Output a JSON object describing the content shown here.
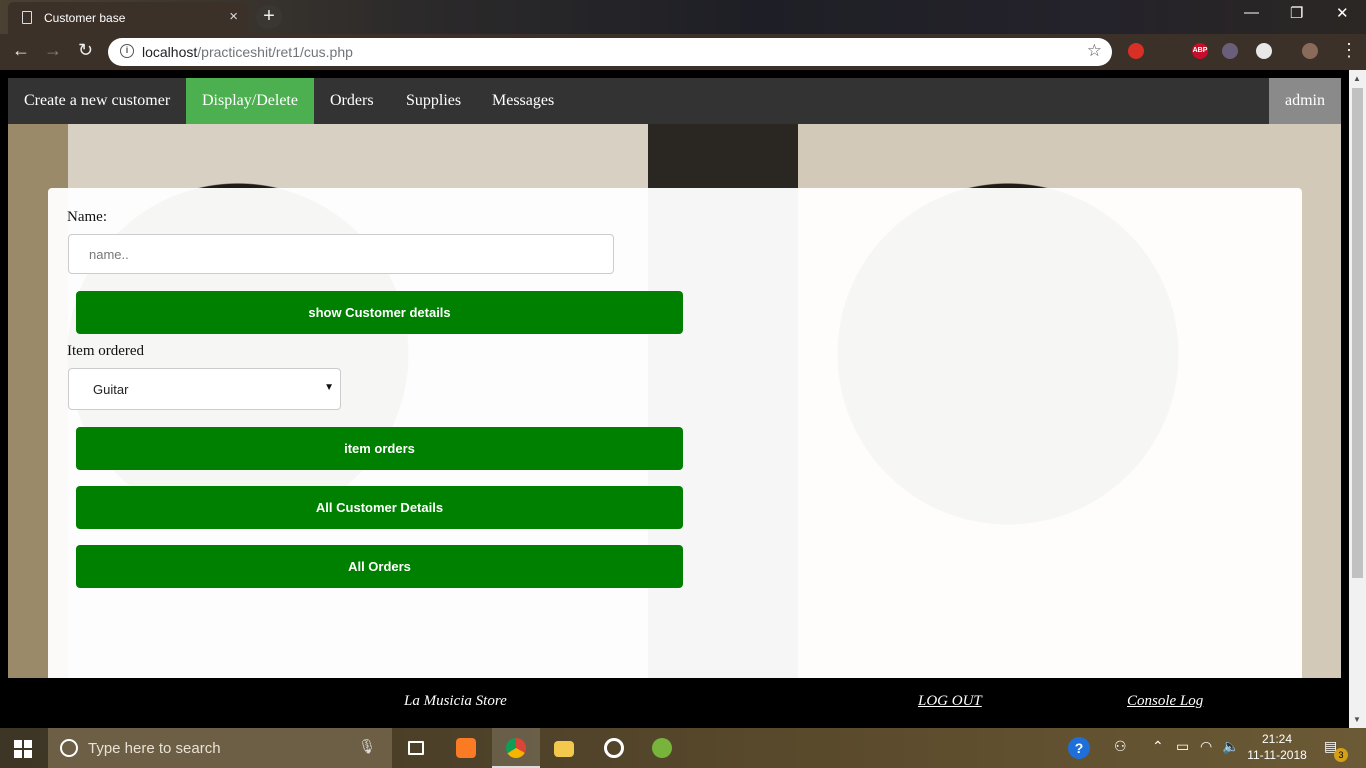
{
  "browser": {
    "tab_title": "Customer base",
    "url_host": "localhost",
    "url_path": "/practiceshit/ret1/cus.php",
    "ext_abp": "ABP"
  },
  "nav": {
    "items": [
      {
        "label": "Create a new customer"
      },
      {
        "label": "Display/Delete",
        "active": true
      },
      {
        "label": "Orders"
      },
      {
        "label": "Supplies"
      },
      {
        "label": "Messages"
      }
    ],
    "user": "admin"
  },
  "form": {
    "name_label": "Name:",
    "name_placeholder": "name..",
    "show_details_button": "show Customer details",
    "item_label": "Item ordered",
    "item_selected": "Guitar",
    "item_orders_button": "item orders",
    "all_customers_button": "All Customer Details",
    "all_orders_button": "All Orders"
  },
  "footer": {
    "store": "La Musicia Store",
    "logout": "LOG OUT",
    "console": "Console Log"
  },
  "taskbar": {
    "search_placeholder": "Type here to search",
    "time": "21:24",
    "date": "11-11-2018",
    "notifications": "3"
  },
  "colors": {
    "nav_bg": "#333333",
    "nav_active": "#4caf50",
    "nav_user": "#8a8a8a",
    "button_green": "#008000"
  }
}
